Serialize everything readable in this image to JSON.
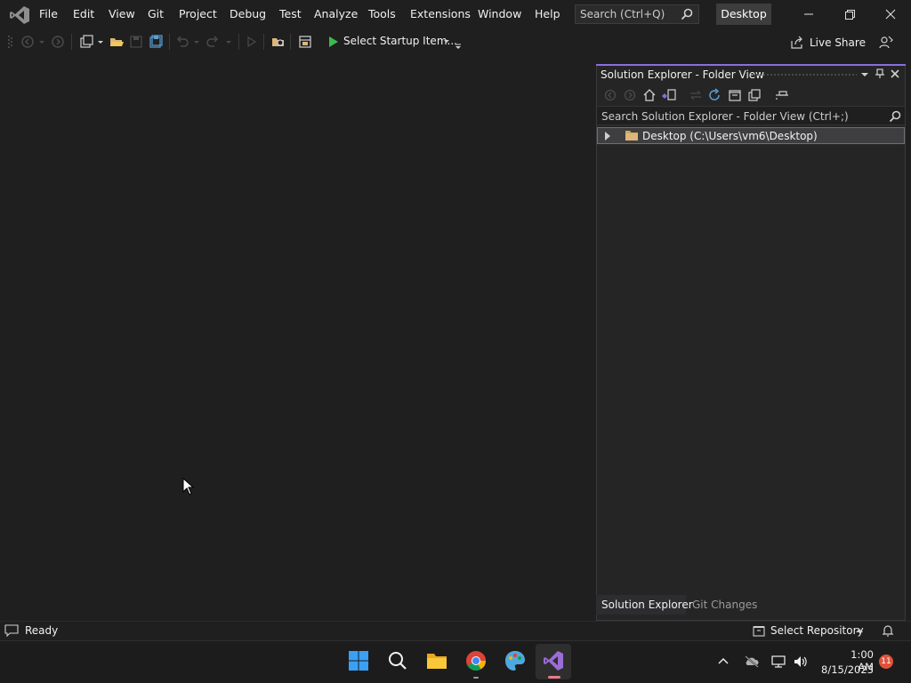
{
  "menu": {
    "items": [
      "File",
      "Edit",
      "View",
      "Git",
      "Project",
      "Debug",
      "Test",
      "Analyze",
      "Tools",
      "Extensions",
      "Window",
      "Help"
    ]
  },
  "search": {
    "placeholder": "Search (Ctrl+Q)"
  },
  "solution_name": "Desktop",
  "toolbar": {
    "startup_label": "Select Startup Item...",
    "live_share_label": "Live Share"
  },
  "solution_explorer": {
    "title": "Solution Explorer - Folder View",
    "search_placeholder": "Search Solution Explorer - Folder View (Ctrl+;)",
    "tree": [
      {
        "label": "Desktop (C:\\Users\\vm6\\Desktop)",
        "expanded": false,
        "selected": true
      }
    ],
    "tabs": [
      "Solution Explorer",
      "Git Changes"
    ],
    "active_tab": "Solution Explorer"
  },
  "status": {
    "text": "Ready",
    "repository": "Select Repository"
  },
  "taskbar": {
    "time": "1:00 AM",
    "date": "8/15/2023",
    "notification_count": "11"
  },
  "colors": {
    "accent": "#8a6ce0",
    "background": "#1f1f1f",
    "panel": "#252526",
    "badge": "#e0533b"
  }
}
